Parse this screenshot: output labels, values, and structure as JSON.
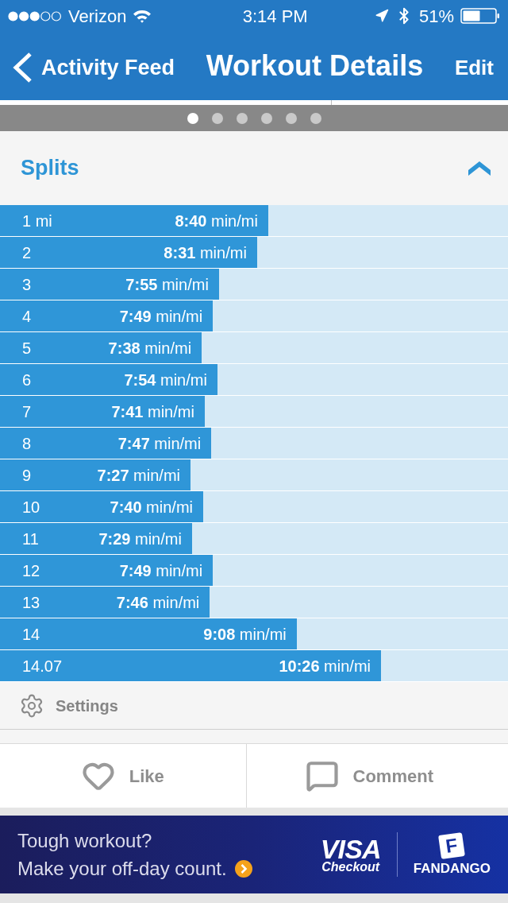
{
  "status_bar": {
    "carrier": "Verizon",
    "time": "3:14 PM",
    "battery": "51%"
  },
  "nav_bar": {
    "back_label": "Activity Feed",
    "title": "Workout Details",
    "action": "Edit"
  },
  "page_indicator": [
    {
      "selected": true
    },
    {
      "selected": false
    },
    {
      "selected": false
    },
    {
      "selected": false
    },
    {
      "selected": false
    },
    {
      "selected": false
    }
  ],
  "splits": {
    "title": "Splits",
    "expanded": true,
    "rows": [
      {
        "label": "1 mi",
        "pace": "**8:40** min/mi",
        "level": 0.528
      },
      {
        "label": "2",
        "pace": "**8:31** min/mi",
        "level": 0.506
      },
      {
        "label": "3",
        "pace": "**7:55** min/mi",
        "level": 0.431
      },
      {
        "label": "4",
        "pace": "**7:49** min/mi",
        "level": 0.419
      },
      {
        "label": "5",
        "pace": "**7:38** min/mi",
        "level": 0.397
      },
      {
        "label": "6",
        "pace": "**7:54** min/mi",
        "level": 0.428
      },
      {
        "label": "7",
        "pace": "**7:41** min/mi",
        "level": 0.403
      },
      {
        "label": "8",
        "pace": "**7:47** min/mi",
        "level": 0.416
      },
      {
        "label": "9",
        "pace": "**7:27** min/mi",
        "level": 0.375
      },
      {
        "label": "10",
        "pace": "**7:40** min/mi",
        "level": 0.4
      },
      {
        "label": "11",
        "pace": "**7:29** min/mi",
        "level": 0.378
      },
      {
        "label": "12",
        "pace": "**7:49** min/mi",
        "level": 0.419
      },
      {
        "label": "13",
        "pace": "**7:46** min/mi",
        "level": 0.413
      },
      {
        "label": "14",
        "pace": "**9:08** min/mi",
        "level": 0.584
      },
      {
        "label": "14.07",
        "pace": "**10:26** min/mi",
        "level": 0.75
      }
    ]
  },
  "settings": {
    "label": "Settings"
  },
  "actions": [
    {
      "kind": "like",
      "label": "Like"
    },
    {
      "kind": "comment",
      "label": "Comment"
    }
  ],
  "ad": {
    "headline": "Tough workout?",
    "tagline": "Make your off-day count.",
    "brands": [
      {
        "kind": "visa",
        "name": "VISA",
        "sub": "Checkout"
      },
      {
        "kind": "fandango",
        "mark": "F",
        "name": "FANDANGO"
      }
    ]
  }
}
